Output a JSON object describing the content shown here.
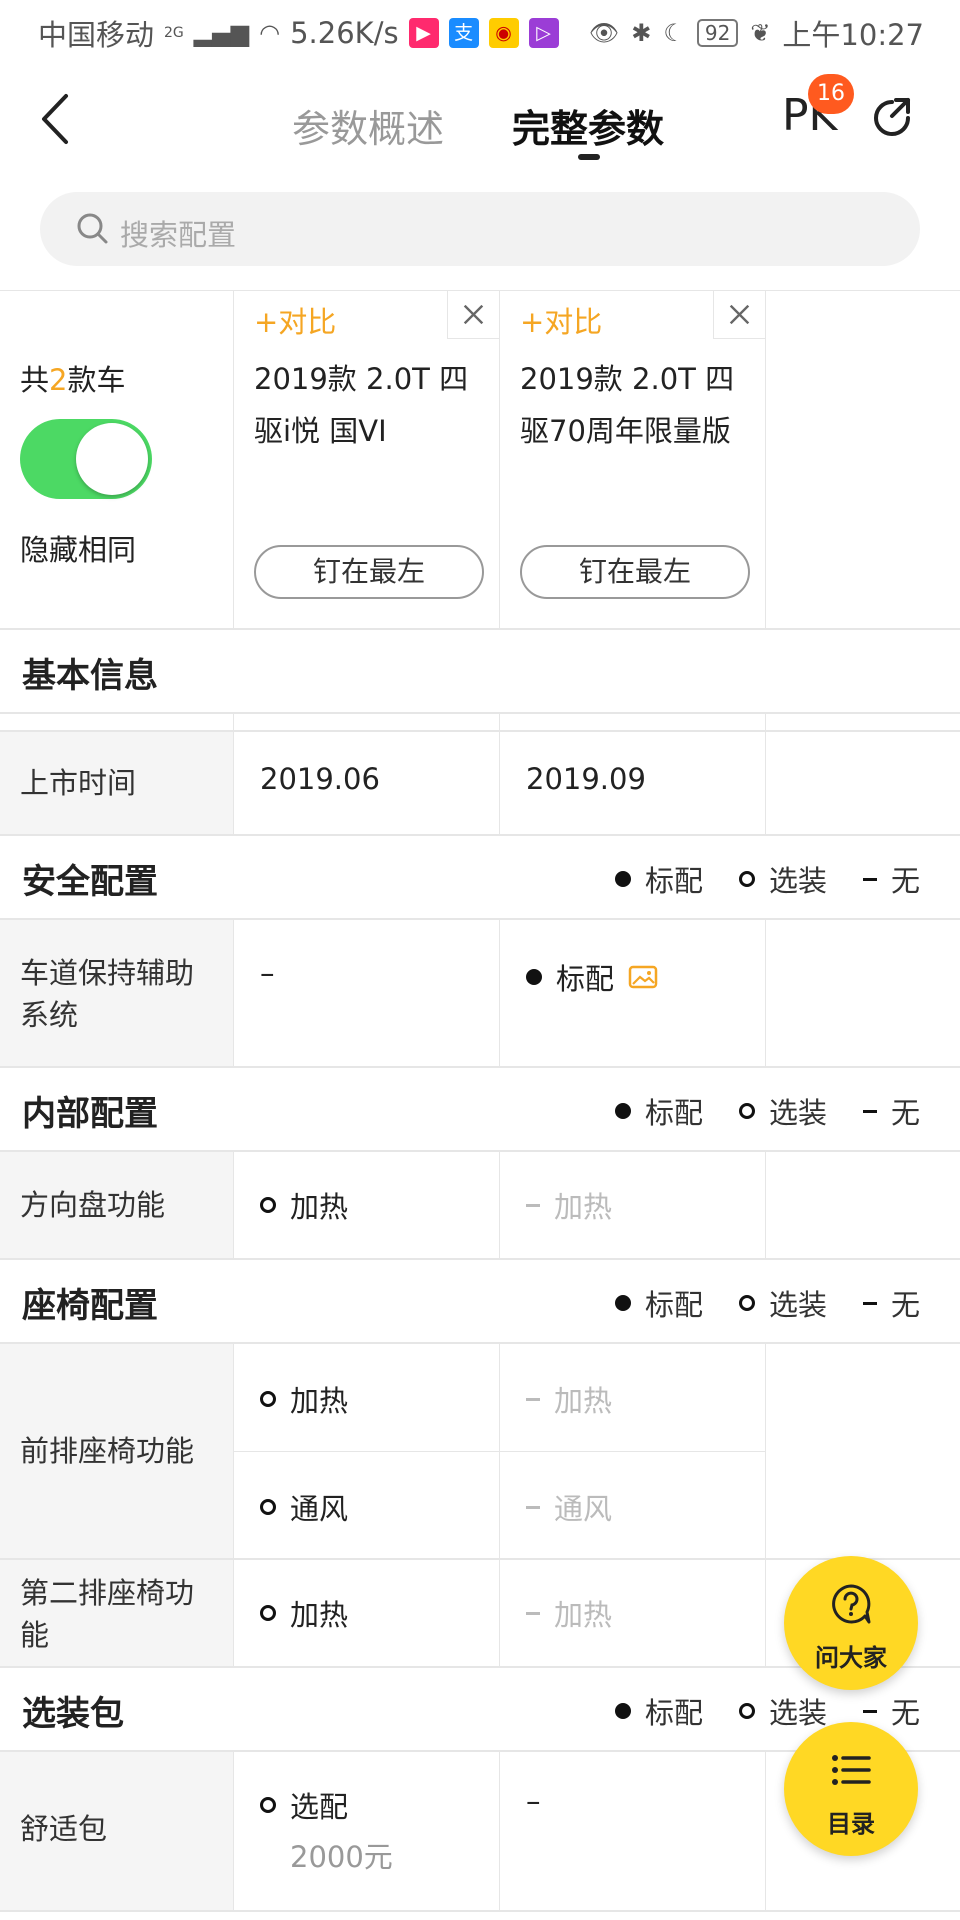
{
  "status_bar": {
    "carrier": "中国移动",
    "network": "2G",
    "speed": "5.26K/s",
    "battery": "92",
    "time": "上午10:27"
  },
  "header": {
    "tabs": [
      {
        "label": "参数概述",
        "active": false
      },
      {
        "label": "完整参数",
        "active": true
      }
    ],
    "pk_label": "PK",
    "pk_badge": "16"
  },
  "search": {
    "placeholder": "搜索配置"
  },
  "car_header": {
    "count_prefix": "共",
    "count": "2",
    "count_suffix": "款车",
    "hide_same_label": "隐藏相同",
    "hide_same_on": true,
    "compare_label": "+对比",
    "pin_label": "钉在最左",
    "cars": [
      {
        "name": "2019款 2.0T 四驱i悦 国VI"
      },
      {
        "name": "2019款 2.0T 四驱70周年限量版"
      }
    ]
  },
  "legend": {
    "standard": "标配",
    "optional": "选装",
    "none": "无"
  },
  "sections": {
    "basic": {
      "title": "基本信息",
      "rows": [
        {
          "label": "上市时间",
          "values": [
            "2019.06",
            "2019.09"
          ]
        }
      ]
    },
    "safety": {
      "title": "安全配置",
      "rows": [
        {
          "label": "车道保持辅助系统",
          "values": [
            "–",
            "标配"
          ]
        }
      ]
    },
    "interior": {
      "title": "内部配置",
      "rows": [
        {
          "label": "方向盘功能",
          "values": [
            "加热",
            "加热"
          ]
        }
      ]
    },
    "seats": {
      "title": "座椅配置",
      "rows": [
        {
          "label": "前排座椅功能",
          "values": [
            [
              "加热",
              "加热"
            ],
            [
              "通风",
              "通风"
            ]
          ]
        },
        {
          "label": "第二排座椅功能",
          "values": [
            "加热",
            "加热"
          ]
        }
      ]
    },
    "packages": {
      "title": "选装包",
      "rows": [
        {
          "label": "舒适包",
          "values": [
            "选配",
            "–"
          ],
          "price": "2000元"
        }
      ]
    }
  },
  "fabs": {
    "ask": "问大家",
    "catalog": "目录"
  },
  "colors": {
    "accent_orange": "#f5a623",
    "toggle_green": "#4cd964",
    "fab_yellow": "#ffd824",
    "badge_orange": "#ff5a1f"
  }
}
